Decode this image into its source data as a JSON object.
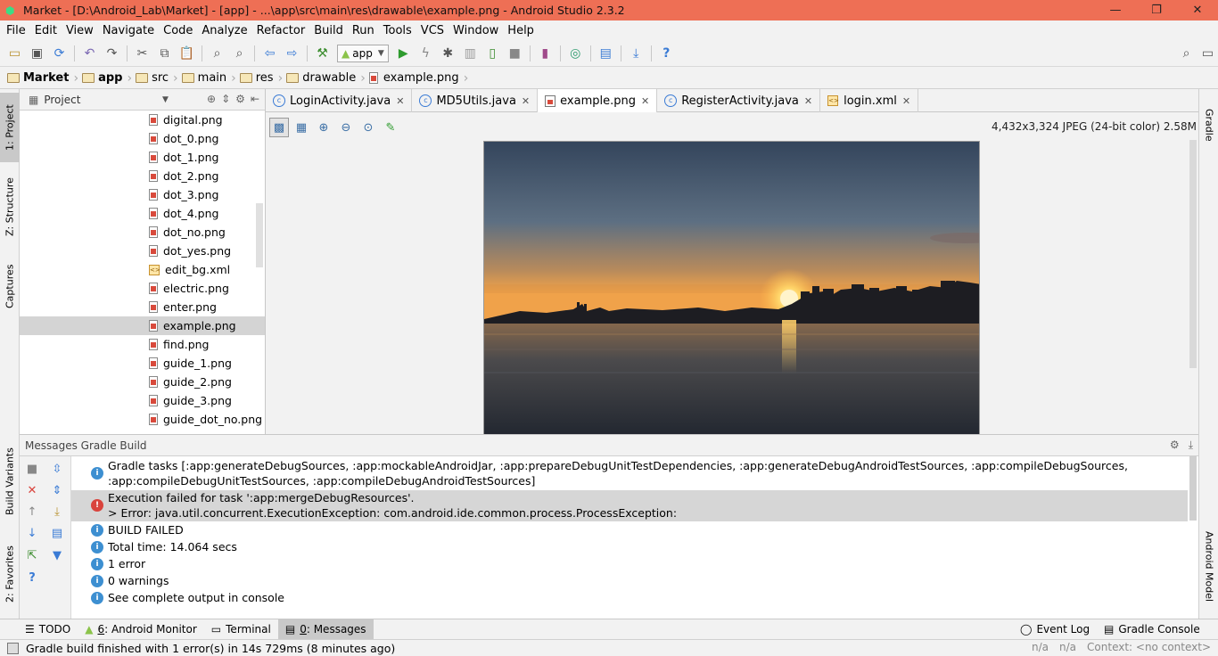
{
  "window": {
    "title": "Market - [D:\\Android_Lab\\Market] - [app] - ...\\app\\src\\main\\res\\drawable\\example.png - Android Studio 2.3.2",
    "controls": [
      "—",
      "❐",
      "✕"
    ]
  },
  "menu": [
    "File",
    "Edit",
    "View",
    "Navigate",
    "Code",
    "Analyze",
    "Refactor",
    "Build",
    "Run",
    "Tools",
    "VCS",
    "Window",
    "Help"
  ],
  "toolbar": {
    "run_config": "app"
  },
  "breadcrumb": [
    "Market",
    "app",
    "src",
    "main",
    "res",
    "drawable",
    "example.png"
  ],
  "left_strip": {
    "project": "1: Project",
    "structure": "Z: Structure",
    "captures": "Captures",
    "build_variants": "Build Variants",
    "favorites": "2: Favorites"
  },
  "right_strip": {
    "gradle": "Gradle",
    "android_model": "Android Model"
  },
  "project_panel": {
    "title": "Project",
    "files": [
      {
        "name": "digital.png",
        "type": "png"
      },
      {
        "name": "dot_0.png",
        "type": "png"
      },
      {
        "name": "dot_1.png",
        "type": "png"
      },
      {
        "name": "dot_2.png",
        "type": "png"
      },
      {
        "name": "dot_3.png",
        "type": "png"
      },
      {
        "name": "dot_4.png",
        "type": "png"
      },
      {
        "name": "dot_no.png",
        "type": "png"
      },
      {
        "name": "dot_yes.png",
        "type": "png"
      },
      {
        "name": "edit_bg.xml",
        "type": "xml"
      },
      {
        "name": "electric.png",
        "type": "png"
      },
      {
        "name": "enter.png",
        "type": "png"
      },
      {
        "name": "example.png",
        "type": "png",
        "selected": true
      },
      {
        "name": "find.png",
        "type": "png"
      },
      {
        "name": "guide_1.png",
        "type": "png"
      },
      {
        "name": "guide_2.png",
        "type": "png"
      },
      {
        "name": "guide_3.png",
        "type": "png"
      },
      {
        "name": "guide_dot_no.png",
        "type": "png"
      }
    ]
  },
  "editor_tabs": [
    {
      "label": "LoginActivity.java",
      "icon": "class-icon"
    },
    {
      "label": "MD5Utils.java",
      "icon": "class-icon"
    },
    {
      "label": "example.png",
      "icon": "image-icon",
      "active": true
    },
    {
      "label": "RegisterActivity.java",
      "icon": "class-icon"
    },
    {
      "label": "login.xml",
      "icon": "xml-icon"
    }
  ],
  "image_viewer": {
    "info": "4,432x3,324 JPEG (24-bit color) 2.58M"
  },
  "messages": {
    "title": "Messages Gradle Build",
    "items": [
      {
        "kind": "info",
        "lines": [
          "Gradle tasks [:app:generateDebugSources, :app:mockableAndroidJar, :app:prepareDebugUnitTestDependencies, :app:generateDebugAndroidTestSources, :app:compileDebugSources,",
          ":app:compileDebugUnitTestSources, :app:compileDebugAndroidTestSources]"
        ]
      },
      {
        "kind": "error",
        "lines": [
          "Execution failed for task ':app:mergeDebugResources'.",
          "> Error: java.util.concurrent.ExecutionException: com.android.ide.common.process.ProcessException:"
        ]
      },
      {
        "kind": "info",
        "lines": [
          "BUILD FAILED"
        ]
      },
      {
        "kind": "info",
        "lines": [
          "Total time: 14.064 secs"
        ]
      },
      {
        "kind": "info",
        "lines": [
          "1 error"
        ]
      },
      {
        "kind": "info",
        "lines": [
          "0 warnings"
        ]
      },
      {
        "kind": "info",
        "lines": [
          "See complete output in console"
        ]
      }
    ]
  },
  "bottom_tabs": {
    "todo": "TODO",
    "android_monitor_num": "6",
    "android_monitor": ": Android Monitor",
    "terminal": "Terminal",
    "messages_num": "0",
    "messages": ": Messages",
    "event_log": "Event Log",
    "gradle_console": "Gradle Console"
  },
  "status": {
    "text": "Gradle build finished with 1 error(s) in 14s 729ms (8 minutes ago)",
    "na1": "n/a",
    "na2": "n/a",
    "context": "Context: <no context>"
  }
}
